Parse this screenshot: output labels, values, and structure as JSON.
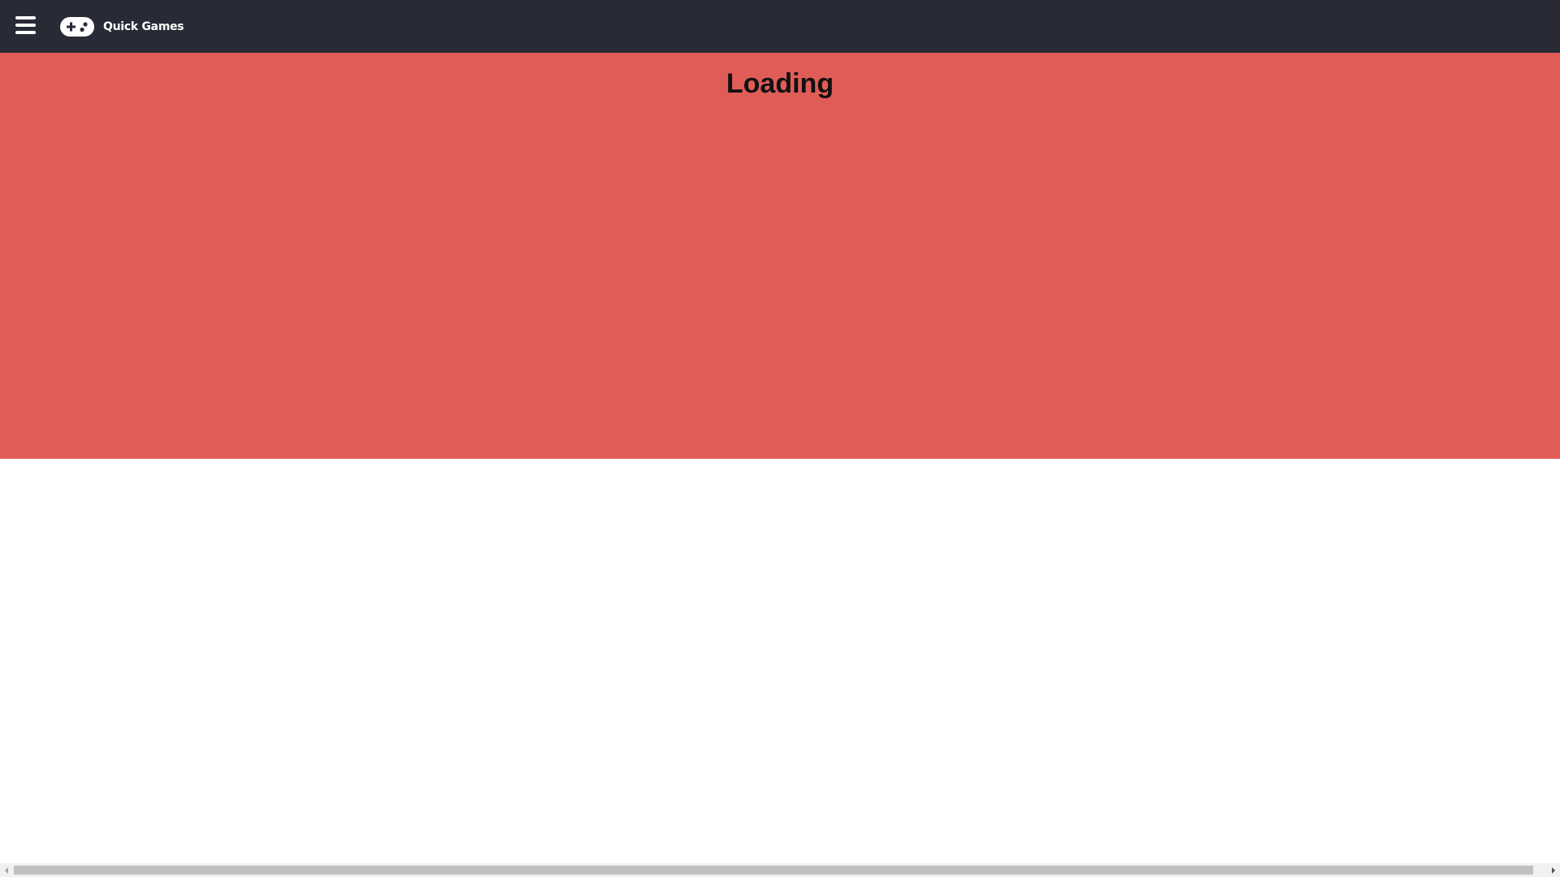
{
  "header": {
    "brand_name": "Quick Games",
    "menu_icon": "hamburger-menu-icon",
    "brand_icon": "gamepad-icon",
    "background": "#282b36"
  },
  "hero": {
    "title": "Loading",
    "background": "#e05d57"
  },
  "scrollbar": {
    "orientation": "horizontal"
  }
}
